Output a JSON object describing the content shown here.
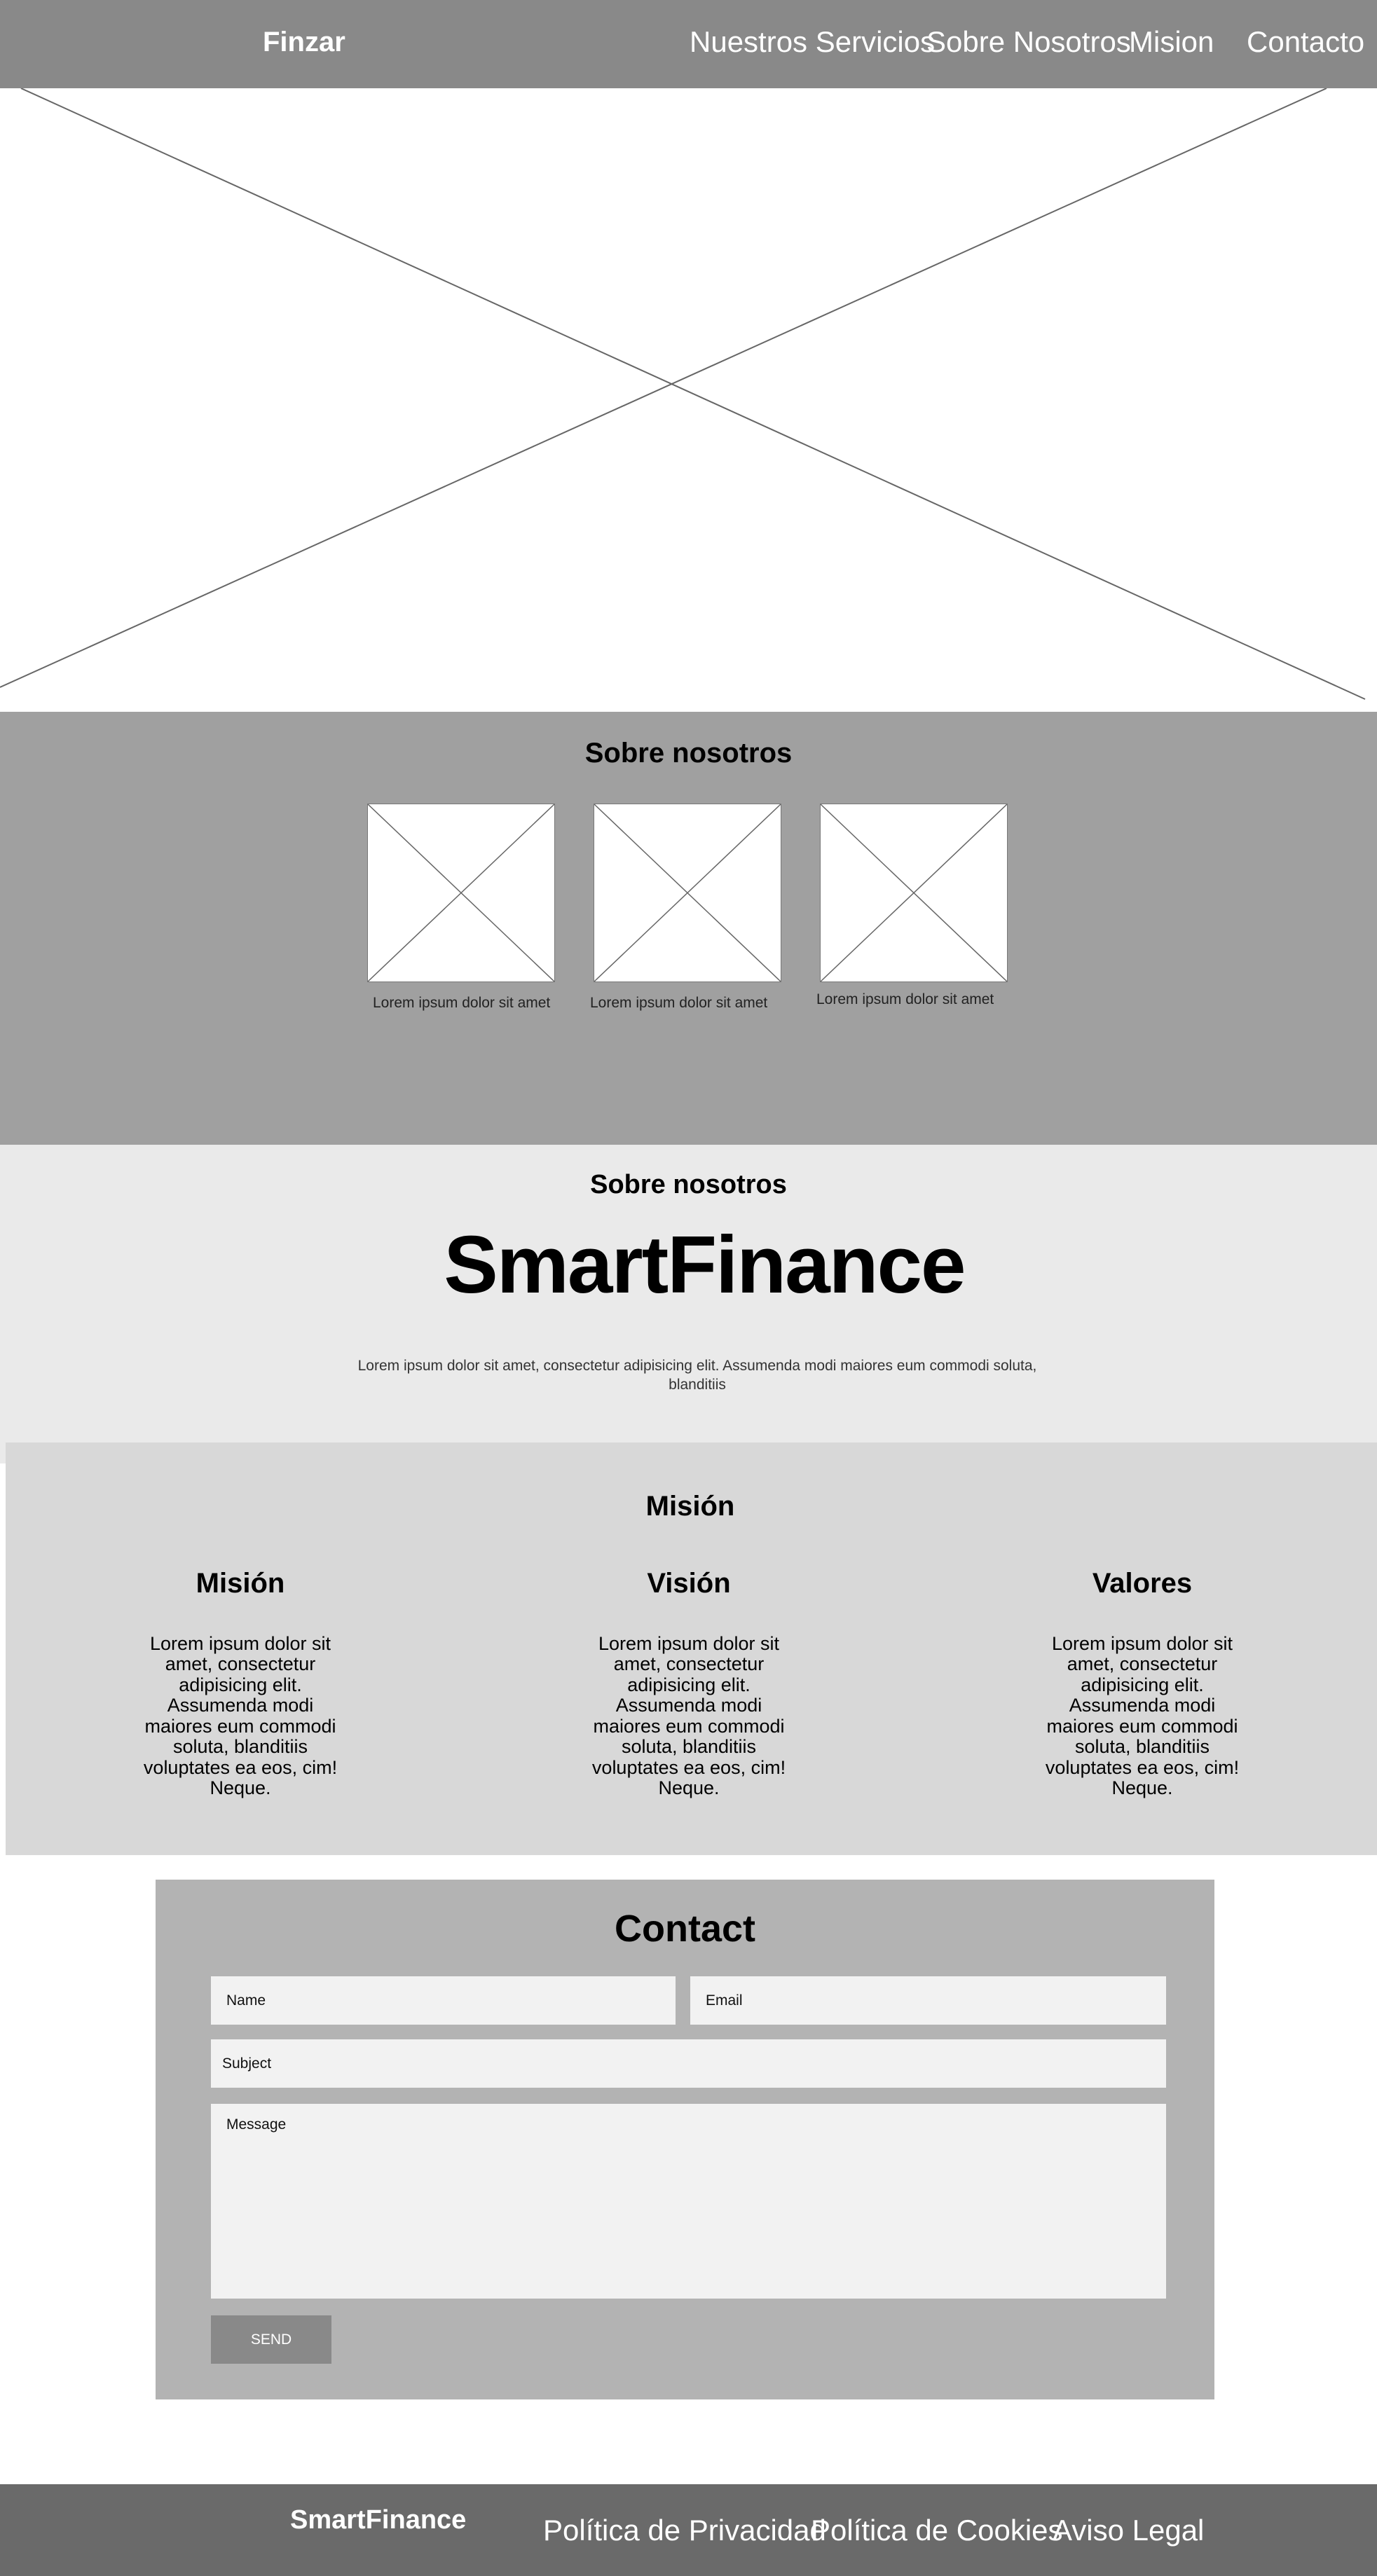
{
  "header": {
    "brand": "Finzar",
    "nav": [
      "Nuestros Servicios",
      "Sobre Nosotros",
      "Mision",
      "Contacto"
    ]
  },
  "hero": {
    "image_icon": "image-placeholder-icon"
  },
  "about": {
    "title": "Sobre nosotros",
    "items": [
      {
        "caption": "Lorem ipsum dolor sit amet"
      },
      {
        "caption": "Lorem ipsum dolor sit amet"
      },
      {
        "caption": "Lorem ipsum dolor sit amet"
      }
    ]
  },
  "brand_section": {
    "subtitle": "Sobre nosotros",
    "name": "SmartFinance",
    "description": "Lorem ipsum dolor sit amet, consectetur adipisicing elit. Assumenda modi maiores eum commodi soluta, blanditiis"
  },
  "mission": {
    "title": "Misión",
    "columns": [
      {
        "title": "Misión",
        "text": "Lorem ipsum dolor sit amet, consectetur adipisicing elit. Assumenda modi maiores eum commodi soluta, blanditiis voluptates ea eos, cim! Neque."
      },
      {
        "title": "Visión",
        "text": "Lorem ipsum dolor sit amet, consectetur adipisicing elit. Assumenda modi maiores eum commodi soluta, blanditiis voluptates ea eos, cim! Neque."
      },
      {
        "title": "Valores",
        "text": "Lorem ipsum dolor sit amet, consectetur adipisicing elit. Assumenda modi maiores eum commodi soluta, blanditiis voluptates ea eos, cim! Neque."
      }
    ]
  },
  "contact": {
    "title": "Contact",
    "name_placeholder": "Name",
    "email_placeholder": "Email",
    "subject_placeholder": "Subject",
    "message_placeholder": "Message",
    "send_label": "SEND"
  },
  "footer": {
    "brand": "SmartFinance",
    "links": [
      "Política de Privacidad",
      "Política de Cookies",
      "Aviso Legal"
    ]
  },
  "colors": {
    "header_bg": "#898989",
    "about_bg": "#a0a0a0",
    "brand_bg": "#eaeaea",
    "mission_bg": "#d8d8d8",
    "contact_bg": "#b3b3b3",
    "footer_bg": "#6a6a6a"
  }
}
